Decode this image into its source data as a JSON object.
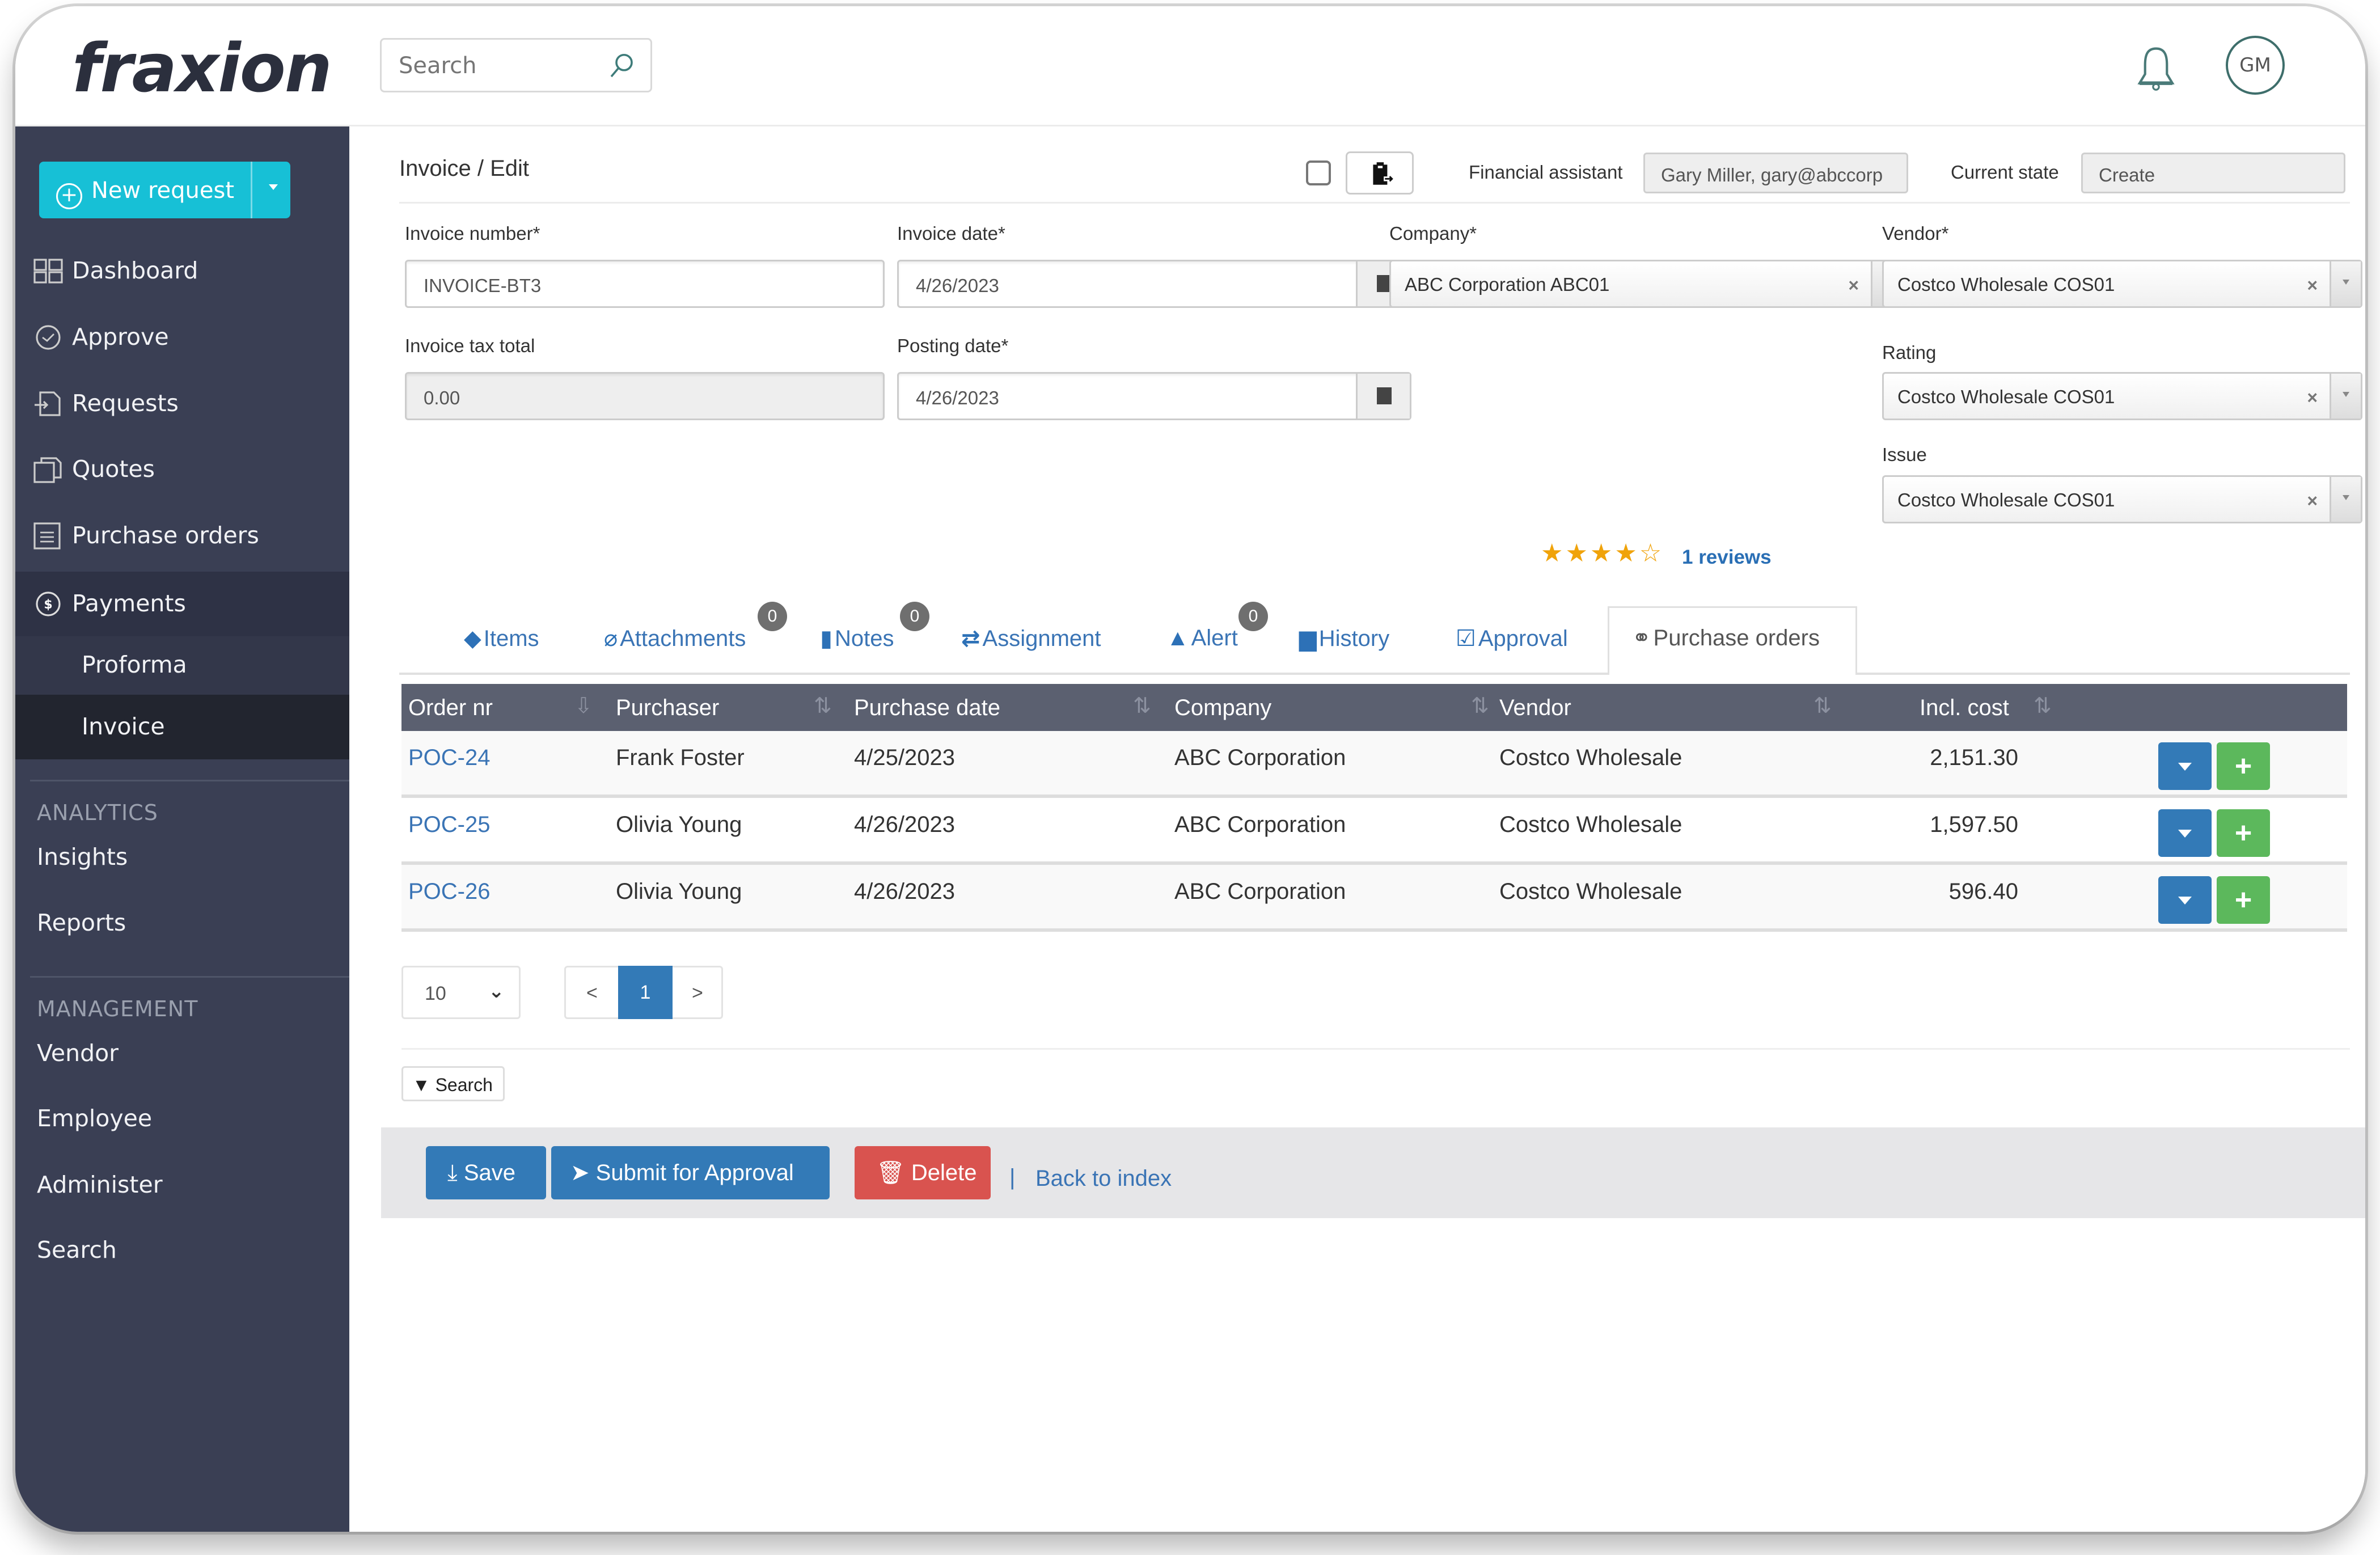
{
  "app": {
    "brand": "fraxion",
    "search_placeholder": "Search",
    "user_initials": "GM"
  },
  "sidebar": {
    "new_request_label": "New request",
    "items": [
      {
        "label": "Dashboard",
        "icon": "dashboard-icon"
      },
      {
        "label": "Approve",
        "icon": "check-circle-icon"
      },
      {
        "label": "Requests",
        "icon": "request-icon"
      },
      {
        "label": "Quotes",
        "icon": "quotes-icon"
      },
      {
        "label": "Purchase orders",
        "icon": "list-document-icon"
      },
      {
        "label": "Payments",
        "icon": "dollar-circle-icon",
        "expanded": true
      }
    ],
    "payments_sub": [
      {
        "label": "Proforma"
      },
      {
        "label": "Invoice",
        "current": true
      }
    ],
    "analytics_title": "ANALYTICS",
    "analytics_items": [
      {
        "label": "Insights"
      },
      {
        "label": "Reports"
      }
    ],
    "management_title": "MANAGEMENT",
    "management_items": [
      {
        "label": "Vendor"
      },
      {
        "label": "Employee"
      },
      {
        "label": "Administer"
      },
      {
        "label": "Search"
      }
    ]
  },
  "page": {
    "breadcrumb": "Invoice / Edit",
    "financial_assistant_label": "Financial assistant",
    "financial_assistant_value": "Gary Miller, gary@abccorp",
    "current_state_label": "Current state",
    "current_state_value": "Create"
  },
  "form": {
    "invoice_number": {
      "label": "Invoice number*",
      "value": "INVOICE-BT3"
    },
    "invoice_date": {
      "label": "Invoice date*",
      "value": "4/26/2023"
    },
    "company": {
      "label": "Company*",
      "value": "ABC Corporation ABC01"
    },
    "vendor": {
      "label": "Vendor*",
      "value": "Costco Wholesale COS01"
    },
    "invoice_tax_total": {
      "label": "Invoice tax total",
      "value": "0.00"
    },
    "posting_date": {
      "label": "Posting date*",
      "value": "4/26/2023"
    },
    "rating": {
      "label": "Rating",
      "value": "Costco Wholesale COS01"
    },
    "issue": {
      "label": "Issue",
      "value": "Costco Wholesale COS01"
    },
    "stars_filled": 4,
    "stars_total": 5,
    "stars_text": "★★★★☆",
    "reviews_label": "1 reviews"
  },
  "tabs": [
    {
      "label": "Items",
      "icon": "tag-icon",
      "glyph": "◆"
    },
    {
      "label": "Attachments",
      "icon": "paperclip-icon",
      "glyph": "⌀",
      "badge": "0"
    },
    {
      "label": "Notes",
      "icon": "comment-icon",
      "glyph": "▮",
      "badge": "0"
    },
    {
      "label": "Assignment",
      "icon": "retweet-icon",
      "glyph": "⇄"
    },
    {
      "label": "Alert",
      "icon": "warning-icon",
      "glyph": "▲",
      "badge": "0"
    },
    {
      "label": "History",
      "icon": "archive-icon",
      "glyph": "▆"
    },
    {
      "label": "Approval",
      "icon": "check-square-icon",
      "glyph": "☑"
    },
    {
      "label": "Purchase orders",
      "icon": "link-icon",
      "glyph": "⚭",
      "active": true
    }
  ],
  "table": {
    "columns": [
      "Order nr",
      "Purchaser",
      "Purchase date",
      "Company",
      "Vendor",
      "Incl. cost"
    ],
    "rows": [
      {
        "order": "POC-24",
        "purchaser": "Frank Foster",
        "date": "4/25/2023",
        "company": "ABC Corporation",
        "vendor": "Costco Wholesale",
        "cost": "2,151.30"
      },
      {
        "order": "POC-25",
        "purchaser": "Olivia Young",
        "date": "4/26/2023",
        "company": "ABC Corporation",
        "vendor": "Costco Wholesale",
        "cost": "1,597.50"
      },
      {
        "order": "POC-26",
        "purchaser": "Olivia Young",
        "date": "4/26/2023",
        "company": "ABC Corporation",
        "vendor": "Costco Wholesale",
        "cost": "596.40"
      }
    ],
    "page_size": "10",
    "current_page": "1",
    "prev": "<",
    "next": ">",
    "search_toggle": "Search"
  },
  "actions": {
    "save": "Save",
    "submit": "Submit for Approval",
    "delete": "Delete",
    "separator": "|",
    "back": "Back to index"
  },
  "colors": {
    "accent": "#17c0d6",
    "sidebar": "#3a3f54",
    "primary": "#337ab7",
    "success": "#5cb85c",
    "danger": "#d9534f",
    "star": "#f0a30a"
  }
}
